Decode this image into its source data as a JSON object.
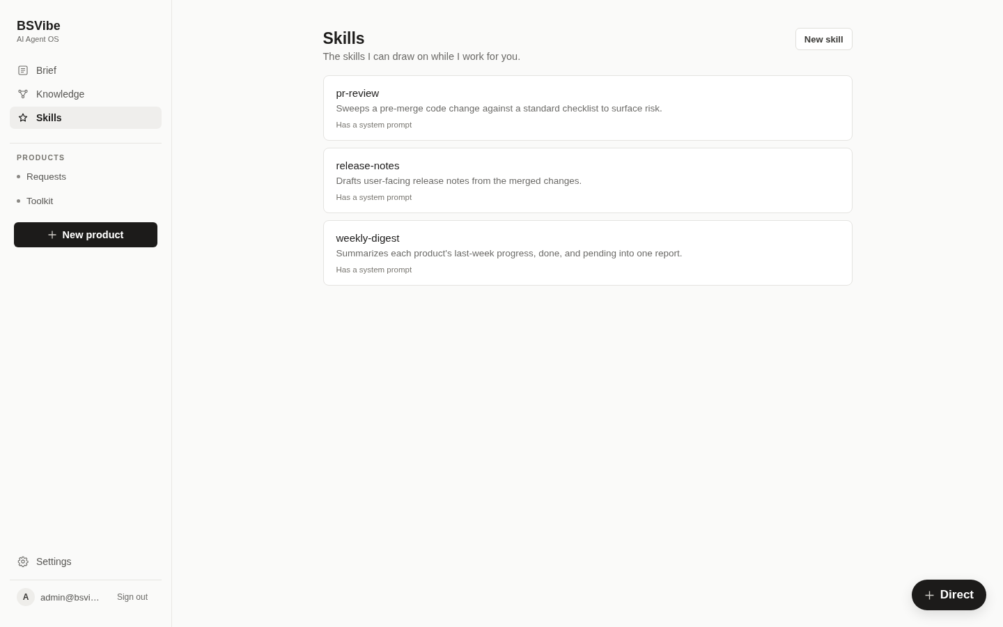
{
  "sidebar": {
    "brand": {
      "name": "BSVibe",
      "tagline": "AI Agent OS"
    },
    "nav": [
      {
        "label": "Brief",
        "selected": false
      },
      {
        "label": "Knowledge",
        "selected": false
      },
      {
        "label": "Skills",
        "selected": true
      }
    ],
    "products": {
      "heading": "PRODUCTS",
      "items": [
        "Requests",
        "Toolkit"
      ]
    },
    "new_product_button": {
      "label": "New product"
    },
    "settings": {
      "label": "Settings"
    },
    "user": {
      "avatar": "A",
      "email": "admin@bsvi…",
      "sign_out": "Sign out"
    }
  },
  "page": {
    "title": "Skills",
    "subtitle": "The skills I can draw on while I work for you.",
    "new_skill_button": "New skill",
    "skills": [
      {
        "name": "pr-review",
        "description": "Sweeps a pre-merge code change against a standard checklist to surface risk.",
        "meta": "Has a system prompt"
      },
      {
        "name": "release-notes",
        "description": "Drafts user-facing release notes from the merged changes.",
        "meta": "Has a system prompt"
      },
      {
        "name": "weekly-digest",
        "description": "Summarizes each product's last-week progress, done, and pending into one report.",
        "meta": "Has a system prompt"
      }
    ]
  },
  "direct_button": {
    "label": "Direct"
  }
}
